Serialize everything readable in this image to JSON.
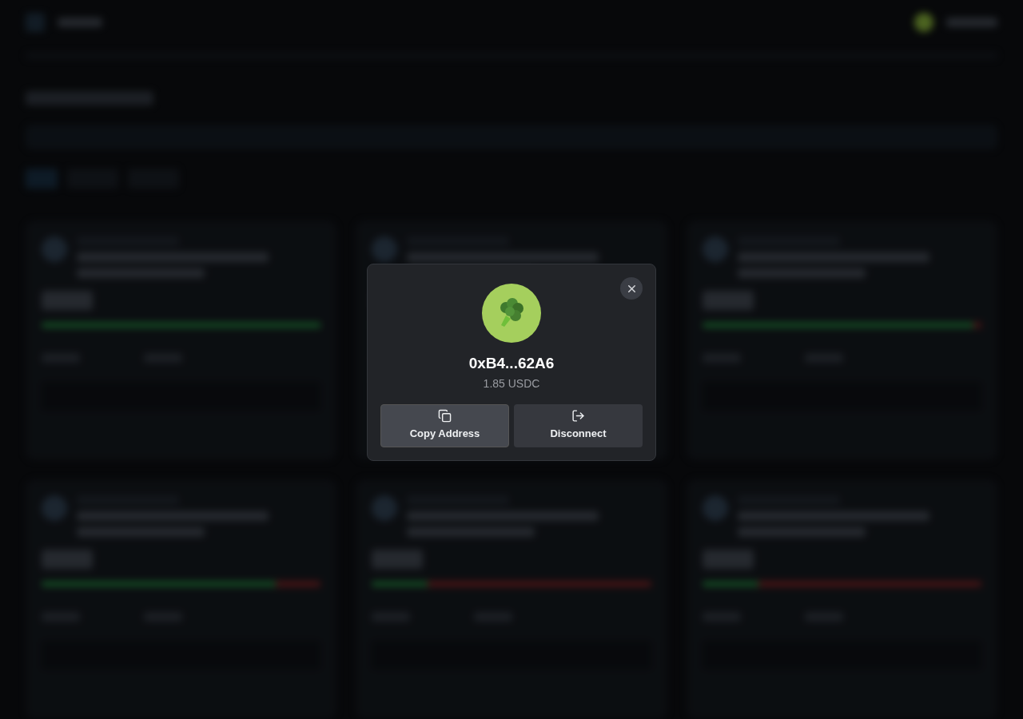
{
  "wallet_dialog": {
    "address": "0xB4...62A6",
    "balance": "1.85 USDC",
    "buttons": [
      {
        "kind": "copy",
        "label": "Copy Address"
      },
      {
        "kind": "disconnect",
        "label": "Disconnect"
      }
    ]
  }
}
